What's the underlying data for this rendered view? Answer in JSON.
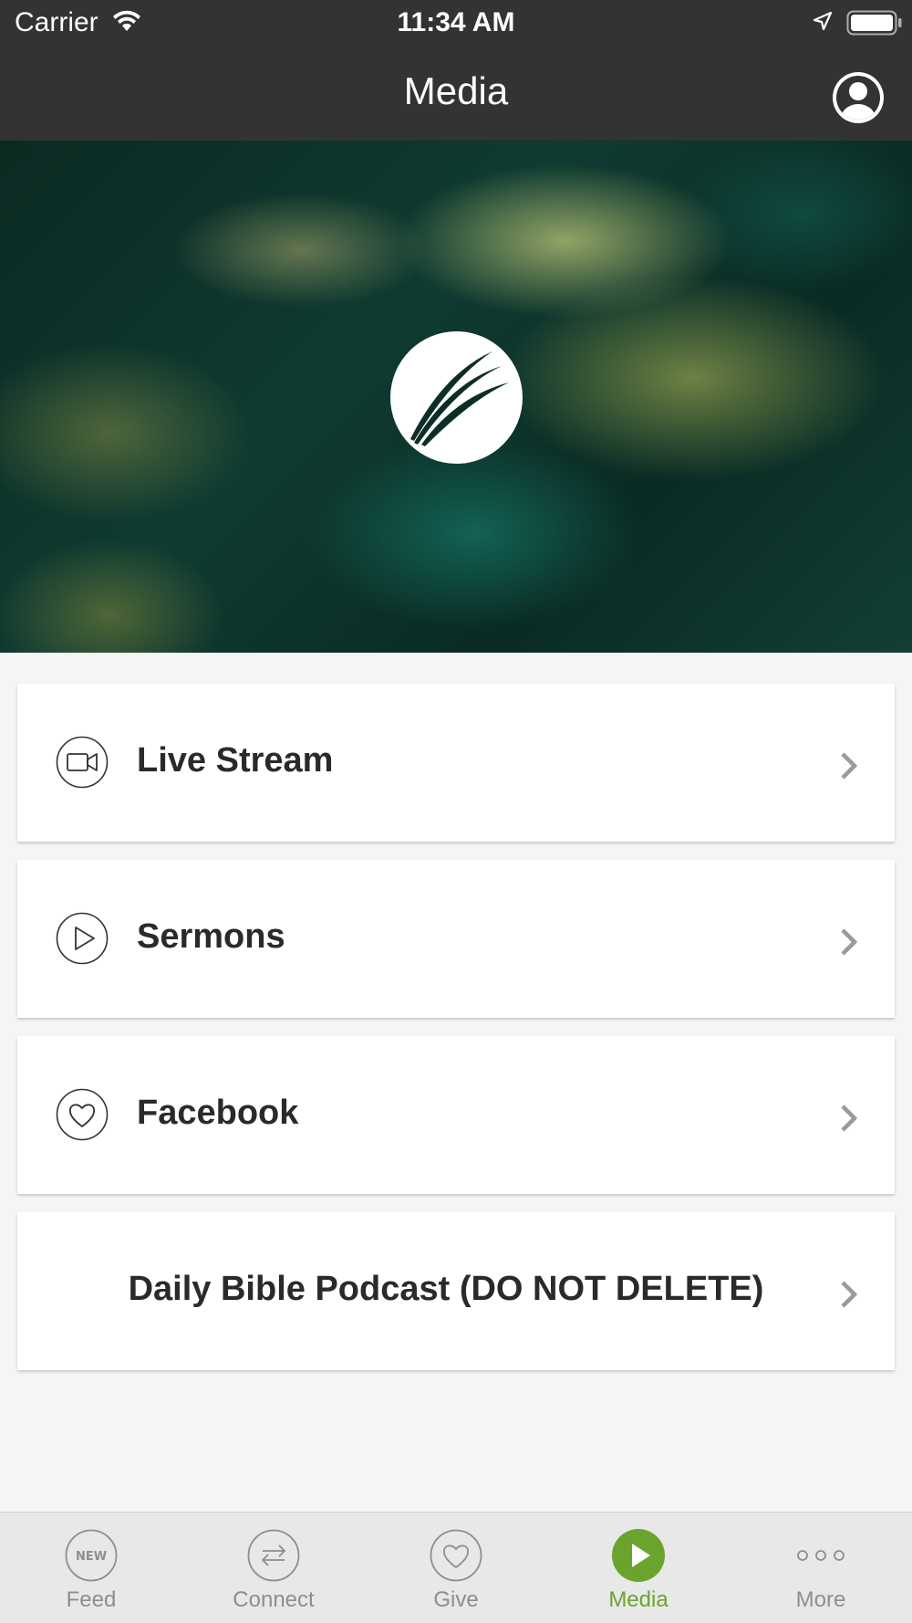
{
  "status_bar": {
    "carrier": "Carrier",
    "time": "11:34 AM"
  },
  "header": {
    "title": "Media",
    "profile_icon": "user-circle-icon"
  },
  "hero": {
    "logo_icon": "church-logo-icon"
  },
  "menu": {
    "items": [
      {
        "label": "Live Stream",
        "icon": "video-camera-icon"
      },
      {
        "label": "Sermons",
        "icon": "play-circle-icon"
      },
      {
        "label": "Facebook",
        "icon": "heart-circle-icon"
      },
      {
        "label": "Daily Bible Podcast (DO NOT DELETE)",
        "icon": ""
      }
    ]
  },
  "tab_bar": {
    "active": "Media",
    "active_color": "#6aa42d",
    "inactive_color": "#8e8e8e",
    "items": [
      {
        "label": "Feed",
        "icon": "new-badge-icon",
        "badge_text": "NEW"
      },
      {
        "label": "Connect",
        "icon": "swap-arrows-icon"
      },
      {
        "label": "Give",
        "icon": "heart-icon"
      },
      {
        "label": "Media",
        "icon": "play-icon"
      },
      {
        "label": "More",
        "icon": "ellipsis-icon"
      }
    ]
  },
  "colors": {
    "nav_background": "#333333",
    "page_background": "#f5f5f5"
  }
}
